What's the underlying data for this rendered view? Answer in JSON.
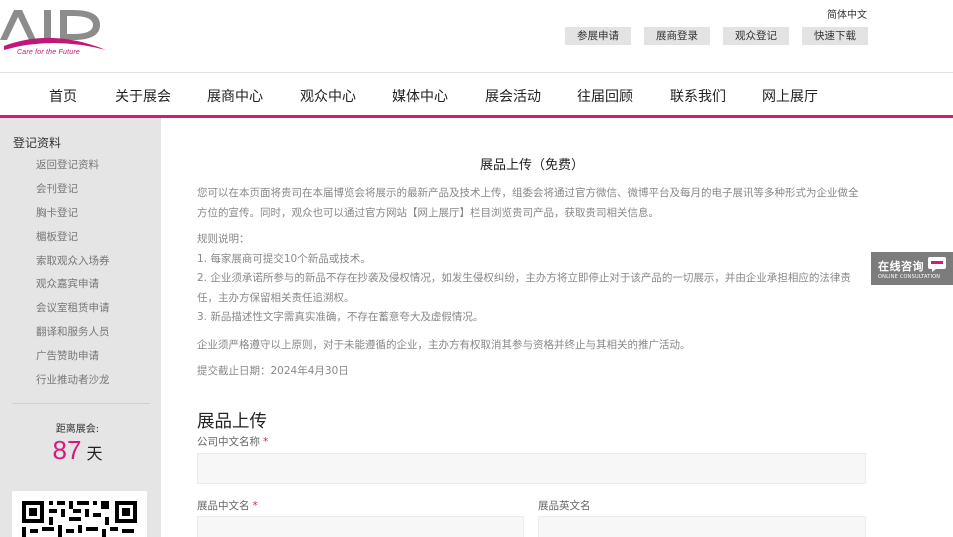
{
  "header": {
    "logo_tagline": "Care for the Future",
    "language": "简体中文",
    "top_buttons": [
      "参展申请",
      "展商登录",
      "观众登记",
      "快速下载"
    ]
  },
  "nav": {
    "items": [
      "首页",
      "关于展会",
      "展商中心",
      "观众中心",
      "媒体中心",
      "展会活动",
      "往届回顾",
      "联系我们",
      "网上展厅"
    ]
  },
  "sidebar": {
    "title": "登记资料",
    "items": [
      "返回登记资料",
      "会刊登记",
      "胸卡登记",
      "楣板登记",
      "索取观众入场券",
      "观众嘉宾申请",
      "会议室租赁申请",
      "翻译和服务人员",
      "广告赞助申请",
      "行业推动者沙龙"
    ],
    "countdown_label": "距离展会:",
    "countdown_value": "87",
    "countdown_unit": "天"
  },
  "main": {
    "title": "展品上传（免费）",
    "intro": "您可以在本页面将贵司在本届博览会将展示的最新产品及技术上传，组委会将通过官方微信、微博平台及每月的电子展讯等多种形式为企业做全方位的宣传。同时，观众也可以通过官方网站【网上展厅】栏目浏览贵司产品，获取贵司相关信息。",
    "rules_heading": "规则说明：",
    "rules": [
      "1. 每家展商可提交10个新品或技术。",
      "2. 企业须承诺所参与的新品不存在抄袭及侵权情况，如发生侵权纠纷，主办方将立即停止对于该产品的一切展示，并由企业承担相应的法律责任，主办方保留相关责任追溯权。",
      "3. 新品描述性文字需真实准确，不存在蓄意夸大及虚假情况。"
    ],
    "notice": "企业须严格遵守以上原则，对于未能遵循的企业，主办方有权取消其参与资格并终止与其相关的推广活动。",
    "deadline": "提交截止日期：2024年4月30日",
    "form_title": "展品上传",
    "fields": {
      "company_cn_label": "公司中文名称",
      "product_cn_label": "展品中文名",
      "product_en_label": "展品英文名",
      "required_mark": "*"
    }
  },
  "consult_widget": {
    "label_cn": "在线咨询",
    "label_en": "ONLINE CONSULTATION"
  },
  "colors": {
    "accent": "#d6197b",
    "sidebar_bg": "#e5e5e5",
    "button_bg": "#e3e3e3"
  }
}
